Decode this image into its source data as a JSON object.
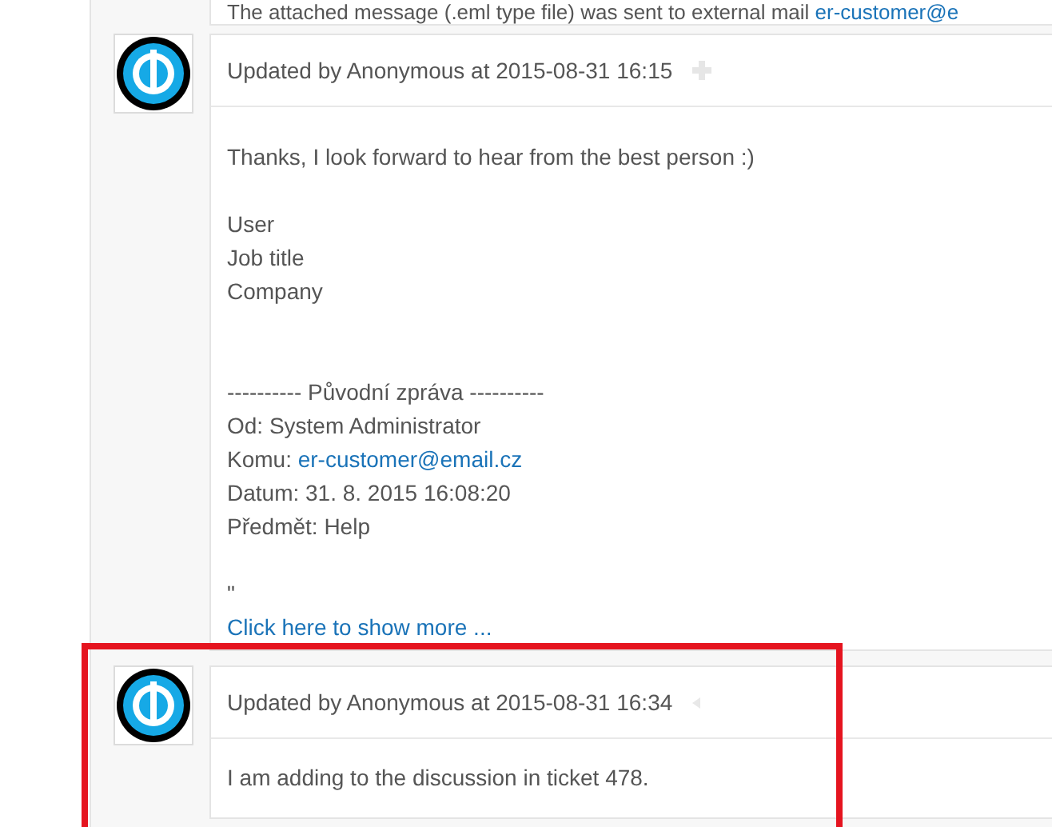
{
  "top_notice": {
    "text": "The attached message (.eml type file) was sent to external mail ",
    "link": "er-customer@e"
  },
  "entries": [
    {
      "header": "Updated by Anonymous at 2015-08-31 16:15",
      "kind": "move",
      "highlighted": false,
      "lines": [
        {
          "kind": "text",
          "text": "Thanks, I look forward to hear from the best person :)"
        },
        {
          "kind": "blank"
        },
        {
          "kind": "text",
          "text": "User"
        },
        {
          "kind": "text",
          "text": "Job title"
        },
        {
          "kind": "text",
          "text": "Company"
        },
        {
          "kind": "blank"
        },
        {
          "kind": "blank"
        },
        {
          "kind": "text",
          "text": "---------- Původní zpráva ----------"
        },
        {
          "kind": "text",
          "text": "Od: System Administrator"
        },
        {
          "kind": "text",
          "text": "Komu: ",
          "link": "er-customer@email.cz"
        },
        {
          "kind": "text",
          "text": "Datum: 31. 8. 2015 16:08:20"
        },
        {
          "kind": "text",
          "text": "Předmět: Help"
        },
        {
          "kind": "blank"
        },
        {
          "kind": "text",
          "text": "\""
        },
        {
          "kind": "link",
          "text": "Click here to show more ..."
        }
      ]
    },
    {
      "header": "Updated by Anonymous at 2015-08-31 16:34",
      "kind": "caret",
      "highlighted": true,
      "lines": [
        {
          "kind": "text",
          "text": "I am adding to the discussion in ticket 478."
        }
      ]
    }
  ]
}
